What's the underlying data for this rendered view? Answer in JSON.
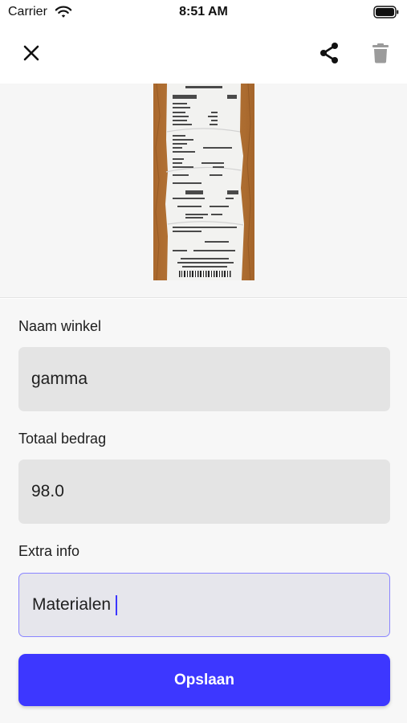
{
  "status_bar": {
    "carrier": "Carrier",
    "time": "8:51 AM"
  },
  "app_bar": {
    "close_icon": "close-icon",
    "share_icon": "share-icon",
    "delete_icon": "trash-icon"
  },
  "receipt_image": {
    "description_icon": "receipt-photo"
  },
  "form": {
    "store_name": {
      "label": "Naam winkel",
      "value": "gamma"
    },
    "total_amount": {
      "label": "Totaal bedrag",
      "value": "98.0"
    },
    "extra_info": {
      "label": "Extra info",
      "value": "Materialen"
    },
    "save_label": "Opslaan"
  },
  "colors": {
    "accent": "#3d37ff",
    "field_background": "#e4e4e4",
    "form_background": "#f7f7f7"
  }
}
